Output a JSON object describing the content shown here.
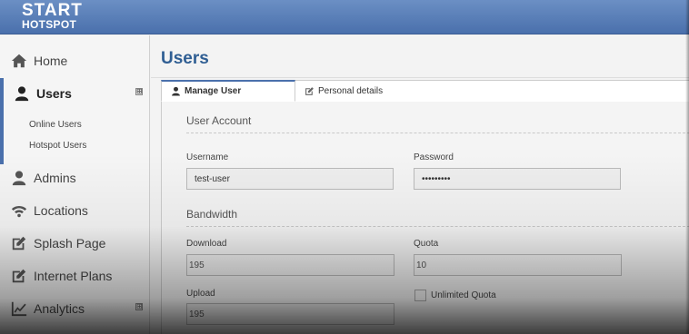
{
  "brand": {
    "line1": "START",
    "line2": "HOTSPOT"
  },
  "sidebar": {
    "items": [
      {
        "label": "Home",
        "icon": "home-icon"
      },
      {
        "label": "Users",
        "icon": "user-icon",
        "active": true,
        "expand": "⊞"
      },
      {
        "label": "Admins",
        "icon": "user-icon"
      },
      {
        "label": "Locations",
        "icon": "wifi-icon"
      },
      {
        "label": "Splash Page",
        "icon": "edit-icon"
      },
      {
        "label": "Internet Plans",
        "icon": "edit-icon"
      },
      {
        "label": "Analytics",
        "icon": "chart-icon",
        "expand": "⊞"
      }
    ],
    "subitems": [
      {
        "label": "Online Users"
      },
      {
        "label": "Hotspot Users"
      }
    ]
  },
  "main": {
    "title": "Users",
    "tabs": [
      {
        "label": "Manage User",
        "icon": "user-icon"
      },
      {
        "label": "Personal details",
        "icon": "edit-icon"
      }
    ]
  },
  "form": {
    "account_title": "User Account",
    "username_label": "Username",
    "username_value": "test-user",
    "password_label": "Password",
    "password_value": "•••••••••",
    "bandwidth_title": "Bandwidth",
    "download_label": "Download",
    "download_value": "195",
    "quota_label": "Quota",
    "quota_value": "10",
    "upload_label": "Upload",
    "upload_value": "195",
    "unlimited_label": "Unlimited Quota"
  },
  "colors": {
    "header": "#4a70ac",
    "title": "#2f5e93",
    "active_accent": "#4a70ac"
  }
}
